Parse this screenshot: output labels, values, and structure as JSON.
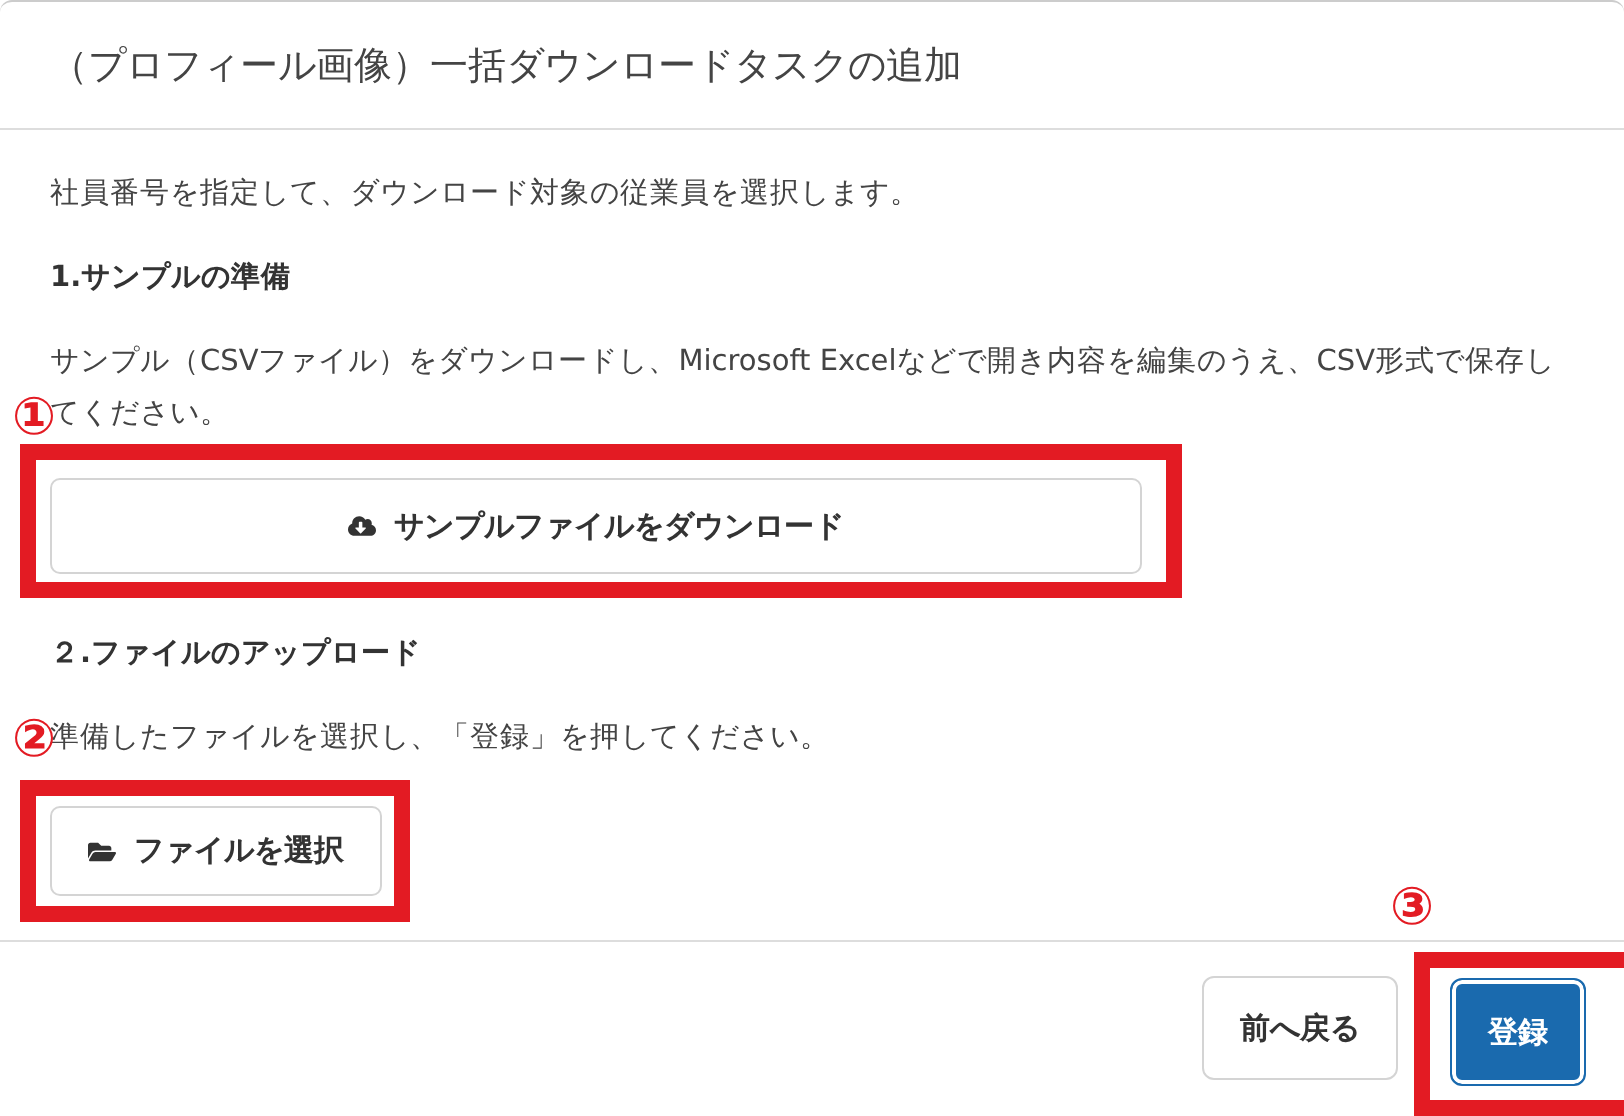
{
  "dialog": {
    "title": "（プロフィール画像）一括ダウンロードタスクの追加"
  },
  "intro": "社員番号を指定して、ダウンロード対象の従業員を選択します。",
  "steps": [
    {
      "heading": "1.サンプルの準備",
      "text": "サンプル（CSVファイル）をダウンロードし、Microsoft Excelなどで開き内容を編集のうえ、CSV形式で保存してください。",
      "button": "サンプルファイルをダウンロード",
      "marker": "①"
    },
    {
      "heading": "２.ファイルのアップロード",
      "text": "準備したファイルを選択し、「登録」を押してください。",
      "button": "ファイルを選択",
      "marker": "②"
    }
  ],
  "footer": {
    "buttons": [
      {
        "label": "前へ戻る",
        "kind": "secondary"
      },
      {
        "label": "登録",
        "kind": "primary",
        "marker": "③"
      }
    ]
  }
}
